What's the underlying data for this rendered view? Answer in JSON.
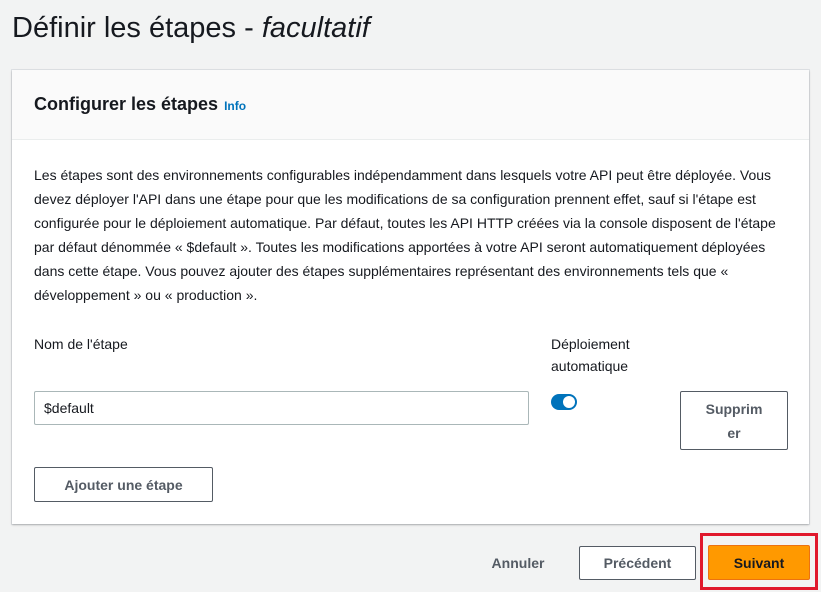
{
  "page": {
    "title_main": "Définir les étapes - ",
    "title_optional": "facultatif"
  },
  "card": {
    "title": "Configurer les étapes",
    "info_link": "Info",
    "description": "Les étapes sont des environnements configurables indépendamment dans lesquels votre API peut être déployée. Vous devez déployer l'API dans une étape pour que les modifications de sa configuration prennent effet, sauf si l'étape est configurée pour le déploiement automatique. Par défaut, toutes les API HTTP créées via la console disposent de l'étape par défaut dénommée « $default ». Toutes les modifications apportées à votre API seront automatiquement déployées dans cette étape. Vous pouvez ajouter des étapes supplémentaires représentant des environnements tels que « développement » ou « production ».",
    "stage_name_label": "Nom de l'étape",
    "auto_deploy_label": "Déploiement automatique",
    "stage_name_value": "$default",
    "auto_deploy_enabled": true,
    "remove_button": "Supprimer",
    "add_stage_button": "Ajouter une étape"
  },
  "footer": {
    "cancel_button": "Annuler",
    "previous_button": "Précédent",
    "next_button": "Suivant"
  },
  "colors": {
    "primary": "#ff9900",
    "link": "#0073bb",
    "toggle_on": "#0073bb",
    "highlight": "#e0182c"
  }
}
